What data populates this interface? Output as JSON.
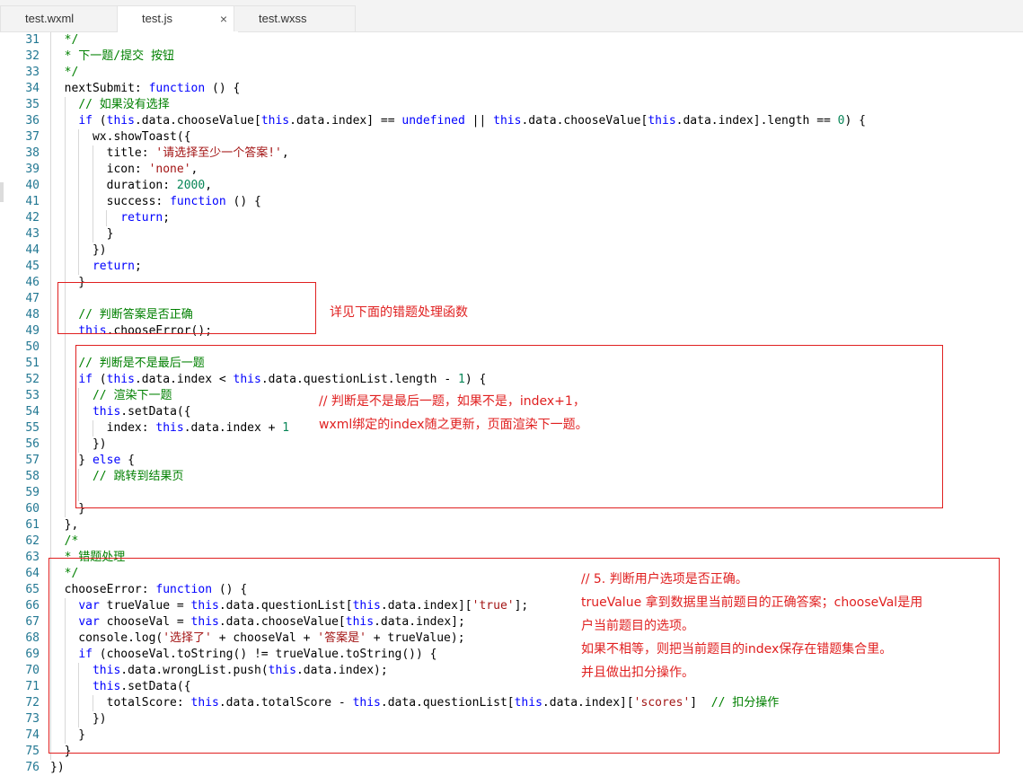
{
  "tabs": [
    {
      "label": "test.wxml",
      "active": false
    },
    {
      "label": "test.js",
      "active": true,
      "close": "×"
    },
    {
      "label": "test.wxss",
      "active": false
    }
  ],
  "lines": [
    {
      "n": "31",
      "indent": 1,
      "tokens": [
        {
          "t": "  */",
          "c": "cm"
        }
      ]
    },
    {
      "n": "32",
      "indent": 1,
      "tokens": [
        {
          "t": "  * 下一题/提交 按钮",
          "c": "cm"
        }
      ]
    },
    {
      "n": "33",
      "indent": 1,
      "tokens": [
        {
          "t": "  */",
          "c": "cm"
        }
      ]
    },
    {
      "n": "34",
      "indent": 1,
      "tokens": [
        {
          "t": "  nextSubmit: ",
          "c": "id"
        },
        {
          "t": "function",
          "c": "kw"
        },
        {
          "t": " () {",
          "c": "id"
        }
      ]
    },
    {
      "n": "35",
      "indent": 2,
      "tokens": [
        {
          "t": "    ",
          "c": "id"
        },
        {
          "t": "// 如果没有选择",
          "c": "cm"
        }
      ]
    },
    {
      "n": "36",
      "indent": 2,
      "tokens": [
        {
          "t": "    ",
          "c": "id"
        },
        {
          "t": "if",
          "c": "kw"
        },
        {
          "t": " (",
          "c": "id"
        },
        {
          "t": "this",
          "c": "kw"
        },
        {
          "t": ".data.chooseValue[",
          "c": "id"
        },
        {
          "t": "this",
          "c": "kw"
        },
        {
          "t": ".data.index] == ",
          "c": "id"
        },
        {
          "t": "undefined",
          "c": "kw"
        },
        {
          "t": " || ",
          "c": "id"
        },
        {
          "t": "this",
          "c": "kw"
        },
        {
          "t": ".data.chooseValue[",
          "c": "id"
        },
        {
          "t": "this",
          "c": "kw"
        },
        {
          "t": ".data.index].length == ",
          "c": "id"
        },
        {
          "t": "0",
          "c": "num"
        },
        {
          "t": ") {",
          "c": "id"
        }
      ]
    },
    {
      "n": "37",
      "indent": 3,
      "tokens": [
        {
          "t": "      wx.showToast({",
          "c": "id"
        }
      ]
    },
    {
      "n": "38",
      "indent": 4,
      "tokens": [
        {
          "t": "        title: ",
          "c": "id"
        },
        {
          "t": "'请选择至少一个答案!'",
          "c": "str"
        },
        {
          "t": ",",
          "c": "id"
        }
      ]
    },
    {
      "n": "39",
      "indent": 4,
      "tokens": [
        {
          "t": "        icon: ",
          "c": "id"
        },
        {
          "t": "'none'",
          "c": "str"
        },
        {
          "t": ",",
          "c": "id"
        }
      ]
    },
    {
      "n": "40",
      "indent": 4,
      "tokens": [
        {
          "t": "        duration: ",
          "c": "id"
        },
        {
          "t": "2000",
          "c": "num"
        },
        {
          "t": ",",
          "c": "id"
        }
      ]
    },
    {
      "n": "41",
      "indent": 4,
      "tokens": [
        {
          "t": "        success: ",
          "c": "id"
        },
        {
          "t": "function",
          "c": "kw"
        },
        {
          "t": " () {",
          "c": "id"
        }
      ]
    },
    {
      "n": "42",
      "indent": 5,
      "tokens": [
        {
          "t": "          ",
          "c": "id"
        },
        {
          "t": "return",
          "c": "kw"
        },
        {
          "t": ";",
          "c": "id"
        }
      ]
    },
    {
      "n": "43",
      "indent": 4,
      "tokens": [
        {
          "t": "        }",
          "c": "id"
        }
      ]
    },
    {
      "n": "44",
      "indent": 3,
      "tokens": [
        {
          "t": "      })",
          "c": "id"
        }
      ]
    },
    {
      "n": "45",
      "indent": 3,
      "tokens": [
        {
          "t": "      ",
          "c": "id"
        },
        {
          "t": "return",
          "c": "kw"
        },
        {
          "t": ";",
          "c": "id"
        }
      ]
    },
    {
      "n": "46",
      "indent": 2,
      "tokens": [
        {
          "t": "    }",
          "c": "id"
        }
      ]
    },
    {
      "n": "47",
      "indent": 2,
      "tokens": []
    },
    {
      "n": "48",
      "indent": 2,
      "tokens": [
        {
          "t": "    ",
          "c": "id"
        },
        {
          "t": "// 判断答案是否正确",
          "c": "cm"
        }
      ]
    },
    {
      "n": "49",
      "indent": 2,
      "tokens": [
        {
          "t": "    ",
          "c": "id"
        },
        {
          "t": "this",
          "c": "kw"
        },
        {
          "t": ".chooseError();",
          "c": "id"
        }
      ]
    },
    {
      "n": "50",
      "indent": 2,
      "tokens": []
    },
    {
      "n": "51",
      "indent": 2,
      "tokens": [
        {
          "t": "    ",
          "c": "id"
        },
        {
          "t": "// 判断是不是最后一题",
          "c": "cm"
        }
      ]
    },
    {
      "n": "52",
      "indent": 2,
      "tokens": [
        {
          "t": "    ",
          "c": "id"
        },
        {
          "t": "if",
          "c": "kw"
        },
        {
          "t": " (",
          "c": "id"
        },
        {
          "t": "this",
          "c": "kw"
        },
        {
          "t": ".data.index < ",
          "c": "id"
        },
        {
          "t": "this",
          "c": "kw"
        },
        {
          "t": ".data.questionList.length - ",
          "c": "id"
        },
        {
          "t": "1",
          "c": "num"
        },
        {
          "t": ") {",
          "c": "id"
        }
      ]
    },
    {
      "n": "53",
      "indent": 3,
      "tokens": [
        {
          "t": "      ",
          "c": "id"
        },
        {
          "t": "// 渲染下一题",
          "c": "cm"
        }
      ]
    },
    {
      "n": "54",
      "indent": 3,
      "tokens": [
        {
          "t": "      ",
          "c": "id"
        },
        {
          "t": "this",
          "c": "kw"
        },
        {
          "t": ".setData({",
          "c": "id"
        }
      ]
    },
    {
      "n": "55",
      "indent": 4,
      "tokens": [
        {
          "t": "        index: ",
          "c": "id"
        },
        {
          "t": "this",
          "c": "kw"
        },
        {
          "t": ".data.index + ",
          "c": "id"
        },
        {
          "t": "1",
          "c": "num"
        }
      ]
    },
    {
      "n": "56",
      "indent": 3,
      "tokens": [
        {
          "t": "      })",
          "c": "id"
        }
      ]
    },
    {
      "n": "57",
      "indent": 2,
      "tokens": [
        {
          "t": "    } ",
          "c": "id"
        },
        {
          "t": "else",
          "c": "kw"
        },
        {
          "t": " {",
          "c": "id"
        }
      ]
    },
    {
      "n": "58",
      "indent": 3,
      "tokens": [
        {
          "t": "      ",
          "c": "id"
        },
        {
          "t": "// 跳转到结果页",
          "c": "cm"
        }
      ]
    },
    {
      "n": "59",
      "indent": 3,
      "tokens": []
    },
    {
      "n": "60",
      "indent": 2,
      "tokens": [
        {
          "t": "    }",
          "c": "id"
        }
      ]
    },
    {
      "n": "61",
      "indent": 1,
      "tokens": [
        {
          "t": "  },",
          "c": "id"
        }
      ]
    },
    {
      "n": "62",
      "indent": 1,
      "tokens": [
        {
          "t": "  /*",
          "c": "cm"
        }
      ]
    },
    {
      "n": "63",
      "indent": 1,
      "tokens": [
        {
          "t": "  * 错题处理",
          "c": "cm"
        }
      ]
    },
    {
      "n": "64",
      "indent": 1,
      "tokens": [
        {
          "t": "  */",
          "c": "cm"
        }
      ]
    },
    {
      "n": "65",
      "indent": 1,
      "tokens": [
        {
          "t": "  chooseError: ",
          "c": "id"
        },
        {
          "t": "function",
          "c": "kw"
        },
        {
          "t": " () {",
          "c": "id"
        }
      ]
    },
    {
      "n": "66",
      "indent": 2,
      "tokens": [
        {
          "t": "    ",
          "c": "id"
        },
        {
          "t": "var",
          "c": "kw"
        },
        {
          "t": " trueValue = ",
          "c": "id"
        },
        {
          "t": "this",
          "c": "kw"
        },
        {
          "t": ".data.questionList[",
          "c": "id"
        },
        {
          "t": "this",
          "c": "kw"
        },
        {
          "t": ".data.index][",
          "c": "id"
        },
        {
          "t": "'true'",
          "c": "str"
        },
        {
          "t": "];",
          "c": "id"
        }
      ]
    },
    {
      "n": "67",
      "indent": 2,
      "tokens": [
        {
          "t": "    ",
          "c": "id"
        },
        {
          "t": "var",
          "c": "kw"
        },
        {
          "t": " chooseVal = ",
          "c": "id"
        },
        {
          "t": "this",
          "c": "kw"
        },
        {
          "t": ".data.chooseValue[",
          "c": "id"
        },
        {
          "t": "this",
          "c": "kw"
        },
        {
          "t": ".data.index];",
          "c": "id"
        }
      ]
    },
    {
      "n": "68",
      "indent": 2,
      "tokens": [
        {
          "t": "    console.log(",
          "c": "id"
        },
        {
          "t": "'选择了'",
          "c": "str"
        },
        {
          "t": " + chooseVal + ",
          "c": "id"
        },
        {
          "t": "'答案是'",
          "c": "str"
        },
        {
          "t": " + trueValue);",
          "c": "id"
        }
      ]
    },
    {
      "n": "69",
      "indent": 2,
      "tokens": [
        {
          "t": "    ",
          "c": "id"
        },
        {
          "t": "if",
          "c": "kw"
        },
        {
          "t": " (chooseVal.toString() != trueValue.toString()) {",
          "c": "id"
        }
      ]
    },
    {
      "n": "70",
      "indent": 3,
      "tokens": [
        {
          "t": "      ",
          "c": "id"
        },
        {
          "t": "this",
          "c": "kw"
        },
        {
          "t": ".data.wrongList.push(",
          "c": "id"
        },
        {
          "t": "this",
          "c": "kw"
        },
        {
          "t": ".data.index);",
          "c": "id"
        }
      ]
    },
    {
      "n": "71",
      "indent": 3,
      "tokens": [
        {
          "t": "      ",
          "c": "id"
        },
        {
          "t": "this",
          "c": "kw"
        },
        {
          "t": ".setData({",
          "c": "id"
        }
      ]
    },
    {
      "n": "72",
      "indent": 4,
      "tokens": [
        {
          "t": "        totalScore: ",
          "c": "id"
        },
        {
          "t": "this",
          "c": "kw"
        },
        {
          "t": ".data.totalScore - ",
          "c": "id"
        },
        {
          "t": "this",
          "c": "kw"
        },
        {
          "t": ".data.questionList[",
          "c": "id"
        },
        {
          "t": "this",
          "c": "kw"
        },
        {
          "t": ".data.index][",
          "c": "id"
        },
        {
          "t": "'scores'",
          "c": "str"
        },
        {
          "t": "]  ",
          "c": "id"
        },
        {
          "t": "// 扣分操作",
          "c": "cm"
        }
      ]
    },
    {
      "n": "73",
      "indent": 3,
      "tokens": [
        {
          "t": "      })",
          "c": "id"
        }
      ]
    },
    {
      "n": "74",
      "indent": 2,
      "tokens": [
        {
          "t": "    }",
          "c": "id"
        }
      ]
    },
    {
      "n": "75",
      "indent": 1,
      "tokens": [
        {
          "t": "  }",
          "c": "id"
        }
      ]
    },
    {
      "n": "76",
      "indent": 0,
      "tokens": [
        {
          "t": "})",
          "c": "id"
        }
      ]
    }
  ],
  "annotations": {
    "note1": "详见下面的错题处理函数",
    "note2": "// 判断是不是最后一题，如果不是，index+1，\nwxml绑定的index随之更新，页面渲染下一题。",
    "note3": "// 5. 判断用户选项是否正确。\ntrueValue 拿到数据里当前题目的正确答案；chooseVal是用\n户当前题目的选项。\n如果不相等，则把当前题目的index保存在错题集合里。\n并且做出扣分操作。"
  },
  "colors": {
    "annotation": "#e02020",
    "keyword": "#0000ff",
    "string": "#a31515",
    "number": "#098658",
    "comment": "#008000"
  }
}
